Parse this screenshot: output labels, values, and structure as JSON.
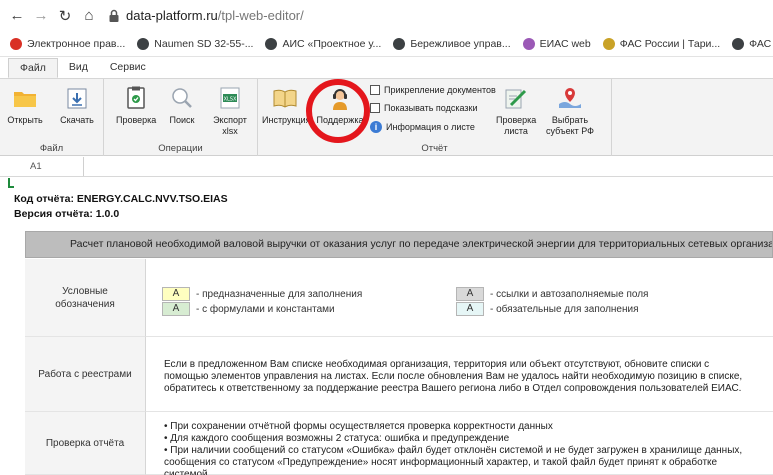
{
  "browser": {
    "url_host": "data-platform.ru",
    "url_path": "/tpl-web-editor/",
    "bookmarks": [
      {
        "label": "Электронное прав...",
        "color": "#d93025"
      },
      {
        "label": "Naumen SD 32-55-...",
        "color": "#3c4043"
      },
      {
        "label": "АИС «Проектное у...",
        "color": "#3c4043"
      },
      {
        "label": "Бережливое управ...",
        "color": "#3c4043"
      },
      {
        "label": "ЕИАС web",
        "color": "#9b59b6"
      },
      {
        "label": "ФАС России | Тари...",
        "color": "#c9a227"
      },
      {
        "label": "ФАС России | Разъ...",
        "color": "#3c4043"
      }
    ]
  },
  "menu": {
    "tabs": [
      "Файл",
      "Вид",
      "Сервис"
    ]
  },
  "ribbon": {
    "file": {
      "label": "Файл",
      "open": "Открыть",
      "download": "Скачать"
    },
    "ops": {
      "label": "Операции",
      "check": "Проверка",
      "search": "Поиск",
      "export_line1": "Экспорт",
      "export_line2": "xlsx"
    },
    "report": {
      "label": "Отчёт",
      "instructions": "Инструкция",
      "support": "Поддержка",
      "attach_docs": "Прикрепление документов",
      "show_hints": "Показывать подсказки",
      "sheet_info": "Информация о листе",
      "check_sheet_line1": "Проверка",
      "check_sheet_line2": "листа",
      "choose_subject_line1": "Выбрать",
      "choose_subject_line2": "субъект РФ"
    }
  },
  "namebox": "A1",
  "sheet": {
    "report_code": "Код отчёта: ENERGY.CALC.NVV.TSO.EIAS",
    "report_version": "Версия отчёта: 1.0.0",
    "banner": "Расчет плановой необходимой валовой выручки от оказания услуг по передаче электрической энергии для территориальных сетевых организаций",
    "legend_title_line1": "Условные",
    "legend_title_line2": "обозначения",
    "legend": [
      {
        "swatch": "А",
        "bg": "#ffffc0",
        "text": "- предназначенные для заполнения"
      },
      {
        "swatch": "А",
        "bg": "#d7ecd2",
        "text": "- с формулами и константами"
      },
      {
        "swatch": "А",
        "bg": "#d9d9d9",
        "text": "- ссылки и автозаполняемые поля"
      },
      {
        "swatch": "А",
        "bg": "#e6f6f6",
        "text": "- обязательные для заполнения"
      }
    ],
    "registry_title": "Работа с реестрами",
    "registry_text": "Если в предложенном Вам списке необходимая организация, территория или объект отсутствуют, обновите списки с помощью элементов управления на листах. Если после обновления Вам не удалось найти необходимую позицию в списке, обратитесь к ответственному за поддержание реестра Вашего региона либо в Отдел сопровождения пользователей ЕИАС.",
    "check_title": "Проверка отчёта",
    "check_items": [
      "• При сохранении отчётной формы осуществляется проверка корректности данных",
      "• Для каждого сообщения возможны 2 статуса: ошибка и предупреждение",
      "• При наличии сообщений со статусом «Ошибка» файл будет отклонён системой и не будет загружен в хранилище данных, сообщения со статусом «Предупреждение» носят информационный характер, и такой файл будет принят к обработке системой"
    ]
  }
}
